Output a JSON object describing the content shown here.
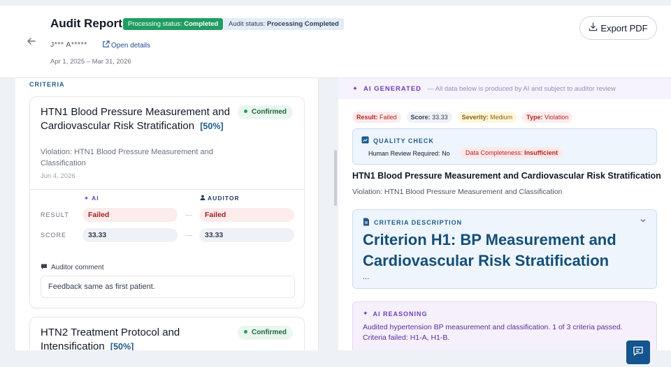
{
  "header": {
    "title": "Audit Report",
    "processing_label": "Processing status:",
    "processing_value": "Completed",
    "audit_label": "Audit status:",
    "audit_value": "Processing Completed",
    "user": "J*** A*****",
    "open_details": "Open details",
    "date_range": "Apr 1, 2025 – Mar 31, 2026",
    "export_label": "Export PDF"
  },
  "left": {
    "section_label": "CRITERIA",
    "card1": {
      "title": "HTN1 Blood Pressure Measurement and Cardiovascular Risk Stratification",
      "percent": "[50%]",
      "status": "Confirmed",
      "violation": "Violation: HTN1 Blood Pressure Measurement and Classification",
      "date": "Jun 4, 2026",
      "ai_header": "AI",
      "auditor_header": "AUDITOR",
      "result_label": "RESULT",
      "score_label": "SCORE",
      "ai_result": "Failed",
      "auditor_result": "Failed",
      "ai_score": "33.33",
      "auditor_score": "33.33",
      "comment_label": "Auditor comment",
      "comment": "Feedback same as first patient."
    },
    "card2": {
      "title": "HTN2 Treatment Protocol and Intensification",
      "percent": "[50%]",
      "status": "Confirmed"
    }
  },
  "right": {
    "ai_label": "AI GENERATED",
    "ai_sub": "— All data below is produced by AI and subject to auditor review",
    "tags": {
      "result_label": "Result:",
      "result_value": "Failed",
      "score_label": "Score:",
      "score_value": "33.33",
      "severity_label": "Severity:",
      "severity_value": "Medium",
      "type_label": "Type:",
      "type_value": "Violation"
    },
    "quality_check": {
      "title": "QUALITY CHECK",
      "human_review_label": "Human Review Required:",
      "human_review_value": "No",
      "completeness_label": "Data Completeness:",
      "completeness_value": "Insufficient"
    },
    "title": "HTN1 Blood Pressure Measurement and Cardiovascular Risk Stratification",
    "violation": "Violation: HTN1 Blood Pressure Measurement and Classification",
    "criteria_description": {
      "title": "CRITERIA DESCRIPTION",
      "heading": "Criterion H1: BP Measurement and Cardiovascular Risk Stratification",
      "ellipsis": "..."
    },
    "ai_reasoning": {
      "title": "AI REASONING",
      "text": "Audited hypertension BP measurement and classification. 1 of 3 criteria passed. Criteria failed: H1-A, H1-B."
    }
  },
  "icons": {
    "back": "arrow-left-icon",
    "open_details": "external-link-icon",
    "export": "download-icon",
    "ai": "sparkle-icon",
    "auditor": "user-icon",
    "comment": "chat-bubble-icon",
    "quality": "chart-icon",
    "description": "document-icon",
    "chevron": "chevron-down-icon",
    "chat": "chat-icon"
  },
  "colors": {
    "processing_badge": "#1f9d62",
    "accent_blue": "#1e5a8c",
    "ai_purple": "#6d3fb5",
    "failed_red": "#b42323"
  }
}
